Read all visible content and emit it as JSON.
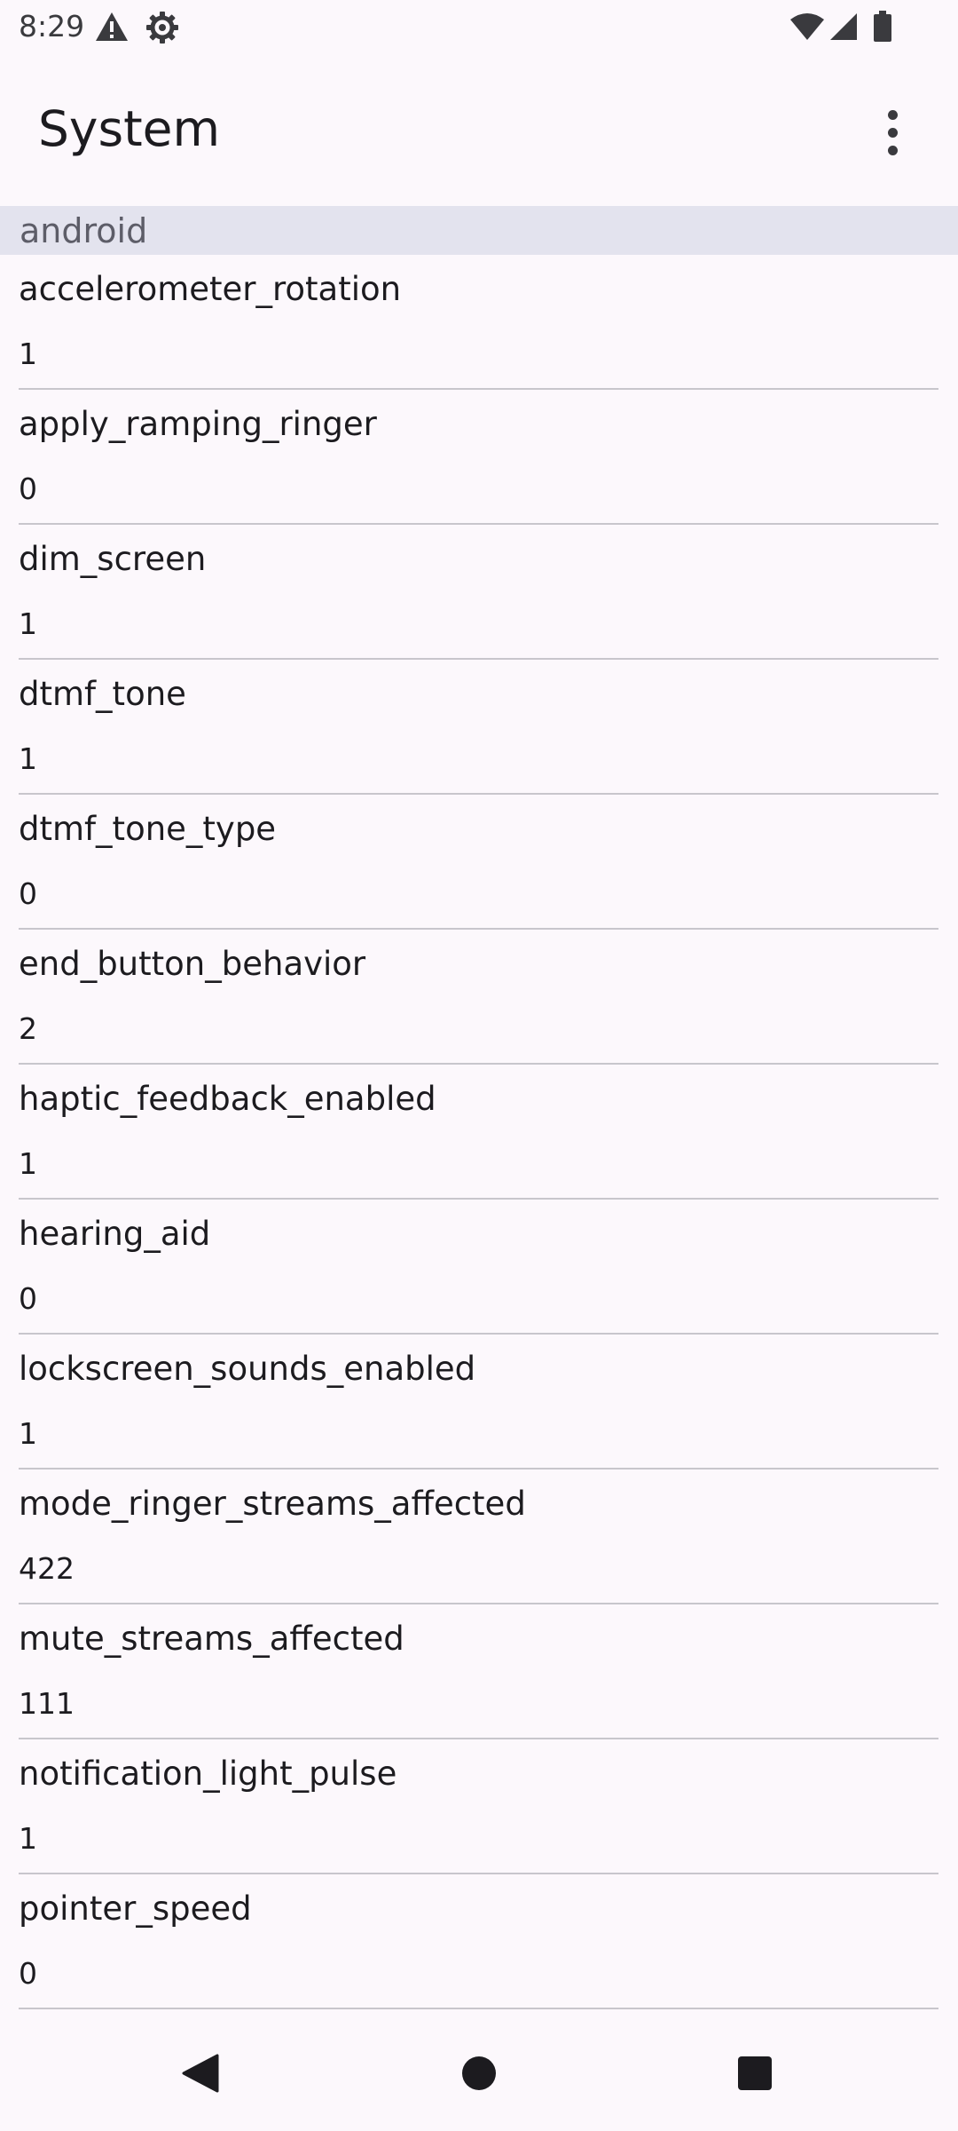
{
  "status_bar": {
    "time": "8:29",
    "icons": [
      "alert-triangle-icon",
      "settings-gear-icon",
      "wifi-icon",
      "cellular-signal-icon",
      "battery-icon"
    ]
  },
  "app_bar": {
    "title": "System",
    "overflow_icon": "more-vert-icon"
  },
  "section": {
    "label": "android"
  },
  "settings": [
    {
      "key": "accelerometer_rotation",
      "value": "1"
    },
    {
      "key": "apply_ramping_ringer",
      "value": "0"
    },
    {
      "key": "dim_screen",
      "value": "1"
    },
    {
      "key": "dtmf_tone",
      "value": "1"
    },
    {
      "key": "dtmf_tone_type",
      "value": "0"
    },
    {
      "key": "end_button_behavior",
      "value": "2"
    },
    {
      "key": "haptic_feedback_enabled",
      "value": "1"
    },
    {
      "key": "hearing_aid",
      "value": "0"
    },
    {
      "key": "lockscreen_sounds_enabled",
      "value": "1"
    },
    {
      "key": "mode_ringer_streams_affected",
      "value": "422"
    },
    {
      "key": "mute_streams_affected",
      "value": "111"
    },
    {
      "key": "notification_light_pulse",
      "value": "1"
    },
    {
      "key": "pointer_speed",
      "value": "0"
    }
  ],
  "nav_bar": {
    "buttons": [
      "back-icon",
      "home-icon",
      "recents-icon"
    ]
  },
  "colors": {
    "background": "#fcf8fc",
    "section_header_bg": "#e3e3ee",
    "divider": "#c8c6cc",
    "text_primary": "#1c1b1f",
    "icon": "#3a3a3e"
  }
}
